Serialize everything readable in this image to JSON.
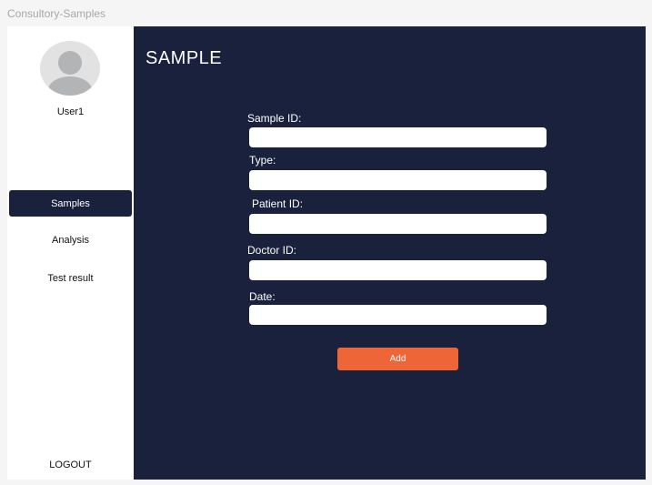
{
  "window": {
    "title": "Consultory-Samples"
  },
  "sidebar": {
    "user": {
      "name": "User1",
      "avatar_icon": "user-avatar-icon"
    },
    "items": [
      {
        "label": "Samples",
        "active": true
      },
      {
        "label": "Analysis",
        "active": false
      },
      {
        "label": "Test result",
        "active": false
      }
    ],
    "logout_label": "LOGOUT"
  },
  "main": {
    "title": "SAMPLE",
    "form": {
      "fields": [
        {
          "label": "Sample ID:",
          "value": ""
        },
        {
          "label": "Type:",
          "value": ""
        },
        {
          "label": "Patient ID:",
          "value": ""
        },
        {
          "label": "Doctor ID:",
          "value": ""
        },
        {
          "label": "Date:",
          "value": ""
        }
      ],
      "submit_label": "Add"
    }
  },
  "colors": {
    "primary": "#1a213d",
    "accent": "#ee6537",
    "background": "#f5f5f5",
    "sidebar": "#ffffff"
  }
}
